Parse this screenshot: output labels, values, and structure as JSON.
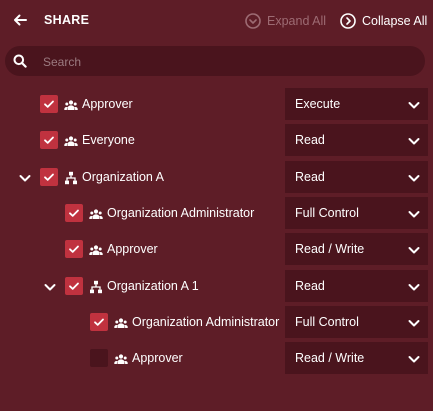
{
  "header": {
    "title": "SHARE",
    "expand_all": "Expand All",
    "collapse_all": "Collapse All"
  },
  "search": {
    "placeholder": "Search"
  },
  "rows": [
    {
      "label": "Approver",
      "type": "group",
      "checked": true,
      "permission": "Execute"
    },
    {
      "label": "Everyone",
      "type": "group",
      "checked": true,
      "permission": "Read"
    },
    {
      "label": "Organization A",
      "type": "org",
      "checked": true,
      "expanded": true,
      "permission": "Read"
    },
    {
      "label": "Organization Administrator",
      "type": "group",
      "checked": true,
      "permission": "Full Control"
    },
    {
      "label": "Approver",
      "type": "group",
      "checked": true,
      "permission": "Read / Write"
    },
    {
      "label": "Organization A 1",
      "type": "org",
      "checked": true,
      "expanded": true,
      "permission": "Read"
    },
    {
      "label": "Organization Administrator",
      "type": "group",
      "checked": true,
      "permission": "Full Control"
    },
    {
      "label": "Approver",
      "type": "group",
      "checked": false,
      "permission": "Read / Write"
    }
  ],
  "colors": {
    "background": "#5e1d27",
    "panel": "#4a141d",
    "checkbox": "#c0323f",
    "muted_text": "#9d6b73"
  }
}
